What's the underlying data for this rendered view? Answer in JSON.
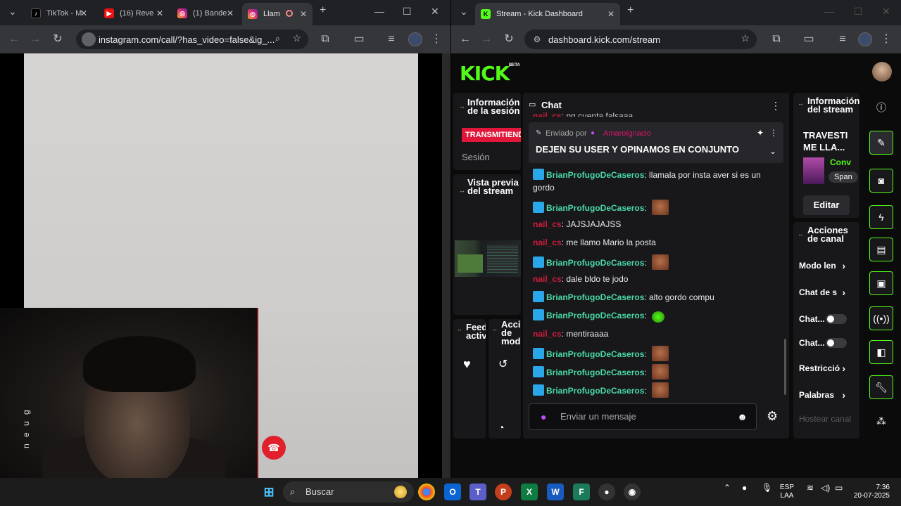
{
  "left_browser": {
    "tabs": [
      {
        "label": "TikTok - M",
        "icon": "tiktok-icon"
      },
      {
        "label": "(16) Reve",
        "icon": "youtube-icon"
      },
      {
        "label": "(1) Bande",
        "icon": "instagram-icon"
      },
      {
        "label": "Llam",
        "icon": "instagram-icon",
        "active": true
      }
    ],
    "url": "instagram.com/call/?has_video=false&ig_...",
    "call": {
      "side_text": "n e u g",
      "hangup_icon": "phone-hangup-icon"
    }
  },
  "right_browser": {
    "tab_title": "Stream - Kick Dashboard",
    "url": "dashboard.kick.com/stream"
  },
  "kick": {
    "logo": "KICK",
    "beta": "BETA",
    "session": {
      "title": "Información de la sesión",
      "status": "TRANSMITIEND",
      "session_label": "Sesión"
    },
    "preview": {
      "title": "Vista previa del stream"
    },
    "feed": {
      "title": "Feed activ"
    },
    "mod": {
      "title": "Acci de mod"
    },
    "chat": {
      "title": "Chat",
      "top_partial": "pq cuenta falsaaa",
      "pinned": {
        "by_label": "Enviado por",
        "by_user": "AmaroIgnacio",
        "message": "DEJEN SU USER Y OPINAMOS EN CONJUNTO"
      },
      "messages": [
        {
          "user": "BrianProfugoDeCaseros",
          "text": "llamala por insta aver si es un",
          "cont": "gordo",
          "color": "g",
          "badge": true
        },
        {
          "user": "BrianProfugoDeCaseros",
          "text": "",
          "emote": true,
          "color": "g",
          "badge": true
        },
        {
          "user": "nail_cs",
          "text": "JAJSJAJAJSS",
          "color": "r"
        },
        {
          "user": "nail_cs",
          "text": "me llamo Mario la posta",
          "color": "r"
        },
        {
          "user": "BrianProfugoDeCaseros",
          "text": "",
          "emote": true,
          "color": "g",
          "badge": true
        },
        {
          "user": "nail_cs",
          "text": "dale bldo te jodo",
          "color": "r"
        },
        {
          "user": "BrianProfugoDeCaseros",
          "text": "alto gordo compu",
          "color": "g",
          "badge": true
        },
        {
          "user": "BrianProfugoDeCaseros",
          "text": "",
          "emote_green": true,
          "color": "g",
          "badge": true
        },
        {
          "user": "nail_cs",
          "text": "mentiraaaa",
          "color": "r"
        },
        {
          "user": "BrianProfugoDeCaseros",
          "text": "",
          "emote": true,
          "color": "g",
          "badge": true
        },
        {
          "user": "BrianProfugoDeCaseros",
          "text": "",
          "emote": true,
          "color": "g",
          "badge": true
        },
        {
          "user": "BrianProfugoDeCaseros",
          "text": "",
          "emote": true,
          "color": "g",
          "badge": true
        }
      ],
      "input_placeholder": "Enviar un mensaje"
    },
    "stream_info": {
      "title": "Información del stream",
      "stream_title": "TRAVESTI ME LLA...",
      "category": "Conv",
      "tag": "Span",
      "edit": "Editar"
    },
    "channel_actions": {
      "title": "Acciones de canal",
      "items": [
        {
          "label": "Modo len",
          "type": "chevron"
        },
        {
          "label": "Chat de s",
          "type": "chevron"
        },
        {
          "label": "Chat...",
          "type": "toggle"
        },
        {
          "label": "Chat...",
          "type": "toggle"
        },
        {
          "label": "Restricció",
          "type": "chevron"
        },
        {
          "label": "Palabras",
          "type": "chevron"
        },
        {
          "label": "Hostear canal",
          "type": "muted"
        }
      ]
    }
  },
  "taskbar": {
    "search": "Buscar",
    "lang": "ESP",
    "lang2": "LAA",
    "time": "7:36",
    "date": "20-07-2025"
  },
  "colors": {
    "kick_green": "#53fc18",
    "chat_user_green": "#4ad9a6",
    "chat_user_red": "#d01c3c"
  }
}
